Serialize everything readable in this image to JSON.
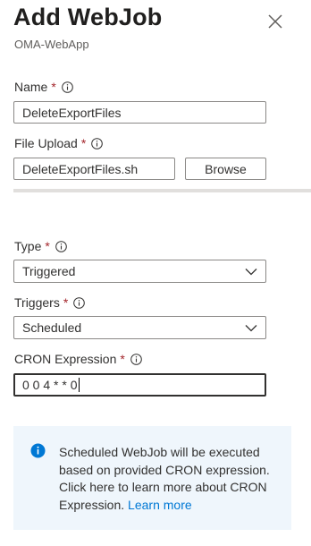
{
  "panel": {
    "title": "Add WebJob",
    "subtitle": "OMA-WebApp"
  },
  "fields": {
    "name": {
      "label": "Name",
      "required_mark": "*",
      "value": "DeleteExportFiles"
    },
    "file_upload": {
      "label": "File Upload",
      "required_mark": "*",
      "value": "DeleteExportFiles.sh",
      "browse_label": "Browse"
    },
    "type": {
      "label": "Type",
      "required_mark": "*",
      "selected": "Triggered"
    },
    "triggers": {
      "label": "Triggers",
      "required_mark": "*",
      "selected": "Scheduled"
    },
    "cron": {
      "label": "CRON Expression",
      "required_mark": "*",
      "value": "0 0 4 * * 0"
    }
  },
  "info_box": {
    "message": "Scheduled WebJob will be executed based on provided CRON expression. Click here to learn more about CRON Expression. ",
    "link_label": "Learn more"
  },
  "colors": {
    "required": "#a4262c",
    "link": "#0078d4",
    "info_icon": "#0078d4",
    "info_background": "#eff6fc"
  },
  "icons": {
    "close": "close-icon",
    "info": "info-icon",
    "chevron": "chevron-down-icon",
    "info_filled": "info-filled-icon"
  }
}
